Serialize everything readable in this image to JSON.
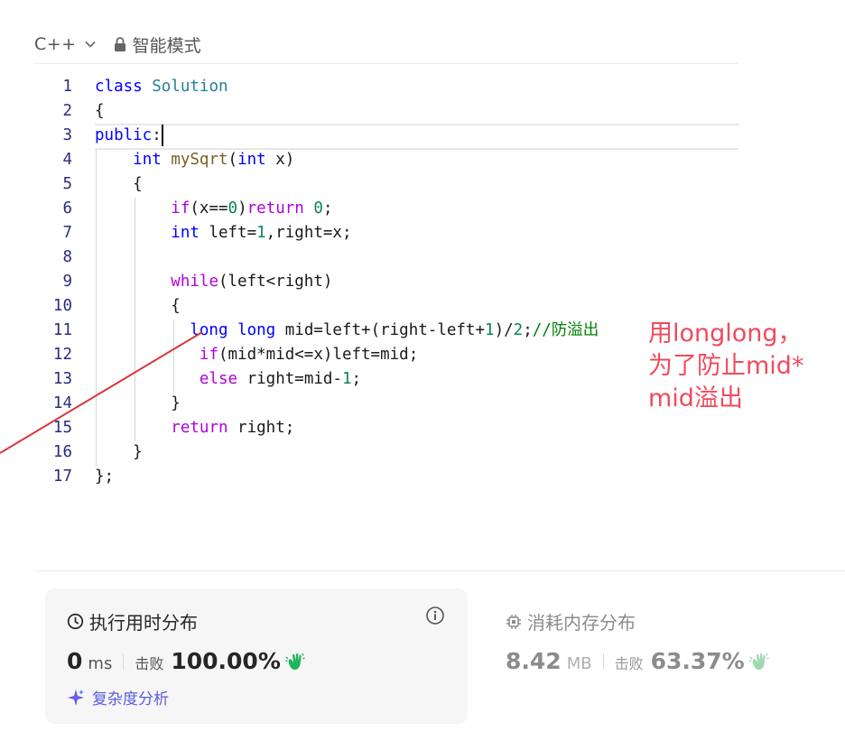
{
  "toolbar": {
    "language": "C++",
    "mode_label": "智能模式",
    "icons": [
      "chevron-down-icon",
      "lock-icon"
    ]
  },
  "code_lines": [
    {
      "n": "1",
      "tokens": [
        [
          "kw",
          "class"
        ],
        [
          "t",
          " "
        ],
        [
          "ty",
          "Solution"
        ]
      ]
    },
    {
      "n": "2",
      "tokens": [
        [
          "t",
          "{"
        ]
      ]
    },
    {
      "n": "3",
      "tokens": [
        [
          "kw",
          "public"
        ],
        [
          "t",
          ":"
        ]
      ]
    },
    {
      "n": "4",
      "tokens": [
        [
          "t",
          "    "
        ],
        [
          "kw",
          "int"
        ],
        [
          "t",
          " "
        ],
        [
          "fn",
          "mySqrt"
        ],
        [
          "t",
          "("
        ],
        [
          "kw",
          "int"
        ],
        [
          "t",
          " x)"
        ]
      ]
    },
    {
      "n": "5",
      "tokens": [
        [
          "t",
          "    {"
        ]
      ]
    },
    {
      "n": "6",
      "tokens": [
        [
          "t",
          "        "
        ],
        [
          "ctl",
          "if"
        ],
        [
          "t",
          "(x=="
        ],
        [
          "num",
          "0"
        ],
        [
          "t",
          ")"
        ],
        [
          "ctl",
          "return"
        ],
        [
          "t",
          " "
        ],
        [
          "num",
          "0"
        ],
        [
          "t",
          ";"
        ]
      ]
    },
    {
      "n": "7",
      "tokens": [
        [
          "t",
          "        "
        ],
        [
          "kw",
          "int"
        ],
        [
          "t",
          " left="
        ],
        [
          "num",
          "1"
        ],
        [
          "t",
          ",right=x;"
        ]
      ]
    },
    {
      "n": "8",
      "tokens": []
    },
    {
      "n": "9",
      "tokens": [
        [
          "t",
          "        "
        ],
        [
          "ctl",
          "while"
        ],
        [
          "t",
          "(left<right)"
        ]
      ]
    },
    {
      "n": "10",
      "tokens": [
        [
          "t",
          "        {"
        ]
      ]
    },
    {
      "n": "11",
      "tokens": [
        [
          "t",
          "          "
        ],
        [
          "kw",
          "long"
        ],
        [
          "t",
          " "
        ],
        [
          "kw",
          "long"
        ],
        [
          "t",
          " mid=left+(right-left+"
        ],
        [
          "num",
          "1"
        ],
        [
          "t",
          ")/"
        ],
        [
          "num",
          "2"
        ],
        [
          "t",
          ";"
        ],
        [
          "cm",
          "//防溢出"
        ]
      ]
    },
    {
      "n": "12",
      "tokens": [
        [
          "t",
          "           "
        ],
        [
          "ctl",
          "if"
        ],
        [
          "t",
          "(mid*mid<=x)left=mid;"
        ]
      ]
    },
    {
      "n": "13",
      "tokens": [
        [
          "t",
          "           "
        ],
        [
          "ctl",
          "else"
        ],
        [
          "t",
          " right=mid-"
        ],
        [
          "num",
          "1"
        ],
        [
          "t",
          ";"
        ]
      ]
    },
    {
      "n": "14",
      "tokens": [
        [
          "t",
          "        }"
        ]
      ]
    },
    {
      "n": "15",
      "tokens": [
        [
          "t",
          "        "
        ],
        [
          "ctl",
          "return"
        ],
        [
          "t",
          " right;"
        ]
      ]
    },
    {
      "n": "16",
      "tokens": [
        [
          "t",
          "    }"
        ]
      ]
    },
    {
      "n": "17",
      "tokens": [
        [
          "t",
          "};"
        ]
      ]
    }
  ],
  "annotation": {
    "lines": [
      "用longlong，",
      "为了防止mid*",
      "mid溢出"
    ],
    "color": "#ef4a5d"
  },
  "runtime": {
    "title": "执行用时分布",
    "value": "0",
    "unit": "ms",
    "beat_label": "击败",
    "beat_value": "100.00%",
    "complexity_link": "复杂度分析",
    "icons": [
      "clock-icon",
      "info-icon",
      "clap-icon",
      "sparkle-icon"
    ]
  },
  "memory": {
    "title": "消耗内存分布",
    "value": "8.42",
    "unit": "MB",
    "beat_label": "击败",
    "beat_value": "63.37%",
    "icons": [
      "chip-icon",
      "clap-icon"
    ]
  },
  "colors": {
    "accent_green": "#1fb35a",
    "link_purple": "#5b5bdc",
    "annotation_red": "#ef4a5d"
  }
}
